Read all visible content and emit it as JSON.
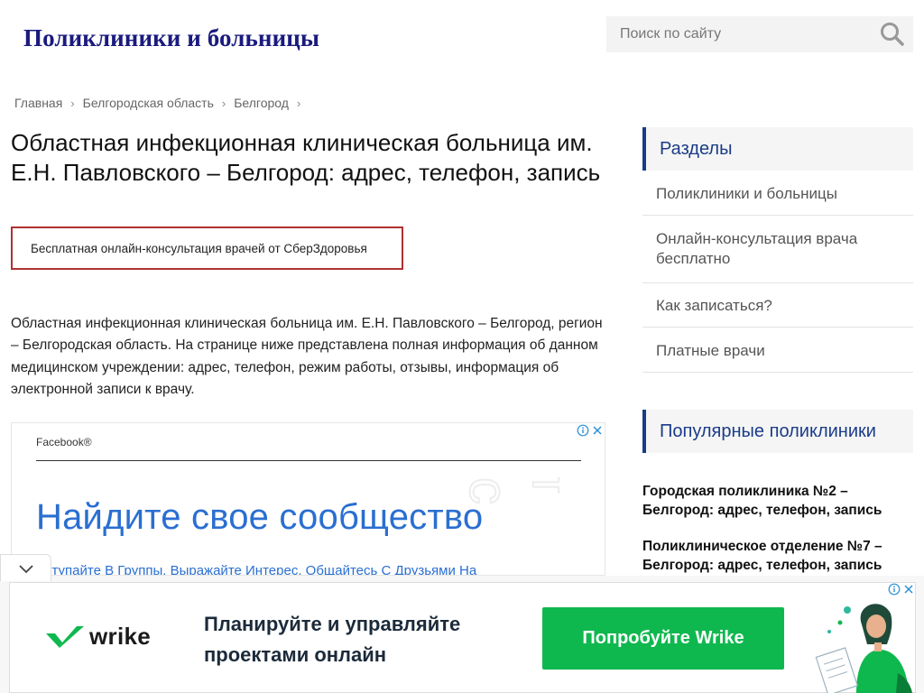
{
  "site": {
    "title": "Поликлиники и больницы"
  },
  "search": {
    "placeholder": "Поиск по сайту"
  },
  "breadcrumb": {
    "items": [
      "Главная",
      "Белгородская область",
      "Белгород"
    ],
    "separator": "›"
  },
  "article": {
    "title": "Областная инфекционная клиническая больница им. Е.Н. Павловского – Белгород: адрес, телефон, запись",
    "promo": "Бесплатная онлайн-консультация врачей от СберЗдоровья",
    "intro": "Областная инфекционная клиническая больница им. Е.Н. Павловского – Белгород, регион – Белгородская область. На странице ниже представлена полная информация об данном медицинском учреждении: адрес, телефон, режим работы, отзывы, информация об электронной записи к врачу."
  },
  "content_ad": {
    "brand": "Facebook®",
    "headline": "Найдите свое сообщество",
    "subline": "Вступайте В Группы. Выражайте Интерес. Общайтесь С Друзьями На",
    "icons": [
      "info-icon",
      "close-icon"
    ]
  },
  "sidebar": {
    "sections_header": "Разделы",
    "nav_items": [
      "Поликлиники и больницы",
      "Онлайн-консультация врача бесплатно",
      "Как записаться?",
      "Платные врачи"
    ],
    "popular_header": "Популярные поликлиники",
    "popular_items": [
      "Городская поликлиника №2 – Белгород: адрес, телефон, запись",
      "Поликлиническое отделение №7 – Белгород: адрес, телефон, запись"
    ]
  },
  "bottom_ad": {
    "logo": "wrike",
    "slogan_line1": "Планируйте и управляйте",
    "slogan_line2": "проектами онлайн",
    "cta": "Попробуйте Wrike",
    "icons": [
      "info-icon",
      "close-icon"
    ]
  },
  "colors": {
    "brand_blue": "#1a1a7e",
    "sidebar_accent": "#1a3c88",
    "promo_border": "#b03030",
    "ad_link_blue": "#2a6fd1",
    "wrike_green": "#0fb84e"
  }
}
